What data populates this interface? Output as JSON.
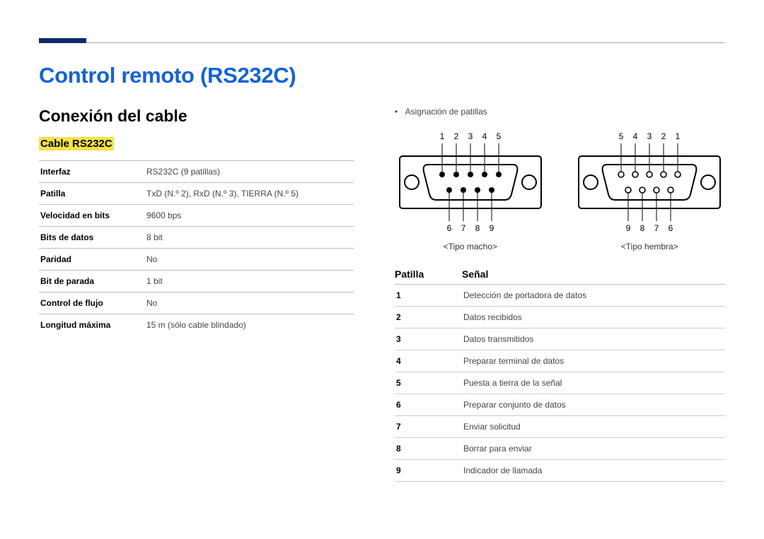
{
  "title": "Control remoto (RS232C)",
  "section": "Conexión del cable",
  "subsection": "Cable RS232C",
  "spec_rows": [
    {
      "k": "Interfaz",
      "v": "RS232C (9 patillas)"
    },
    {
      "k": "Patilla",
      "v": "TxD (N.º 2), RxD (N.º 3), TIERRA (N.º 5)"
    },
    {
      "k": "Velocidad en bits",
      "v": "9600 bps"
    },
    {
      "k": "Bits de datos",
      "v": "8 bit"
    },
    {
      "k": "Paridad",
      "v": "No"
    },
    {
      "k": "Bit de parada",
      "v": "1 bit"
    },
    {
      "k": "Control de flujo",
      "v": "No"
    },
    {
      "k": "Longitud máxima",
      "v": "15 m (sólo cable blindado)"
    }
  ],
  "bullet": "Asignación de patillas",
  "connectors": {
    "male": {
      "top_nums": [
        "1",
        "2",
        "3",
        "4",
        "5"
      ],
      "bottom_nums": [
        "6",
        "7",
        "8",
        "9"
      ],
      "caption": "<Tipo macho>"
    },
    "female": {
      "top_nums": [
        "5",
        "4",
        "3",
        "2",
        "1"
      ],
      "bottom_nums": [
        "9",
        "8",
        "7",
        "6"
      ],
      "caption": "<Tipo hembra>"
    }
  },
  "pin_table": {
    "head_pin": "Patilla",
    "head_signal": "Señal",
    "rows": [
      {
        "pin": "1",
        "signal": "Detección de portadora de datos"
      },
      {
        "pin": "2",
        "signal": "Datos recibidos"
      },
      {
        "pin": "3",
        "signal": "Datos transmitidos"
      },
      {
        "pin": "4",
        "signal": "Preparar terminal de datos"
      },
      {
        "pin": "5",
        "signal": "Puesta a tierra de la señal"
      },
      {
        "pin": "6",
        "signal": "Preparar conjunto de datos"
      },
      {
        "pin": "7",
        "signal": "Enviar solicitud"
      },
      {
        "pin": "8",
        "signal": "Borrar para enviar"
      },
      {
        "pin": "9",
        "signal": "Indicador de llamada"
      }
    ]
  }
}
